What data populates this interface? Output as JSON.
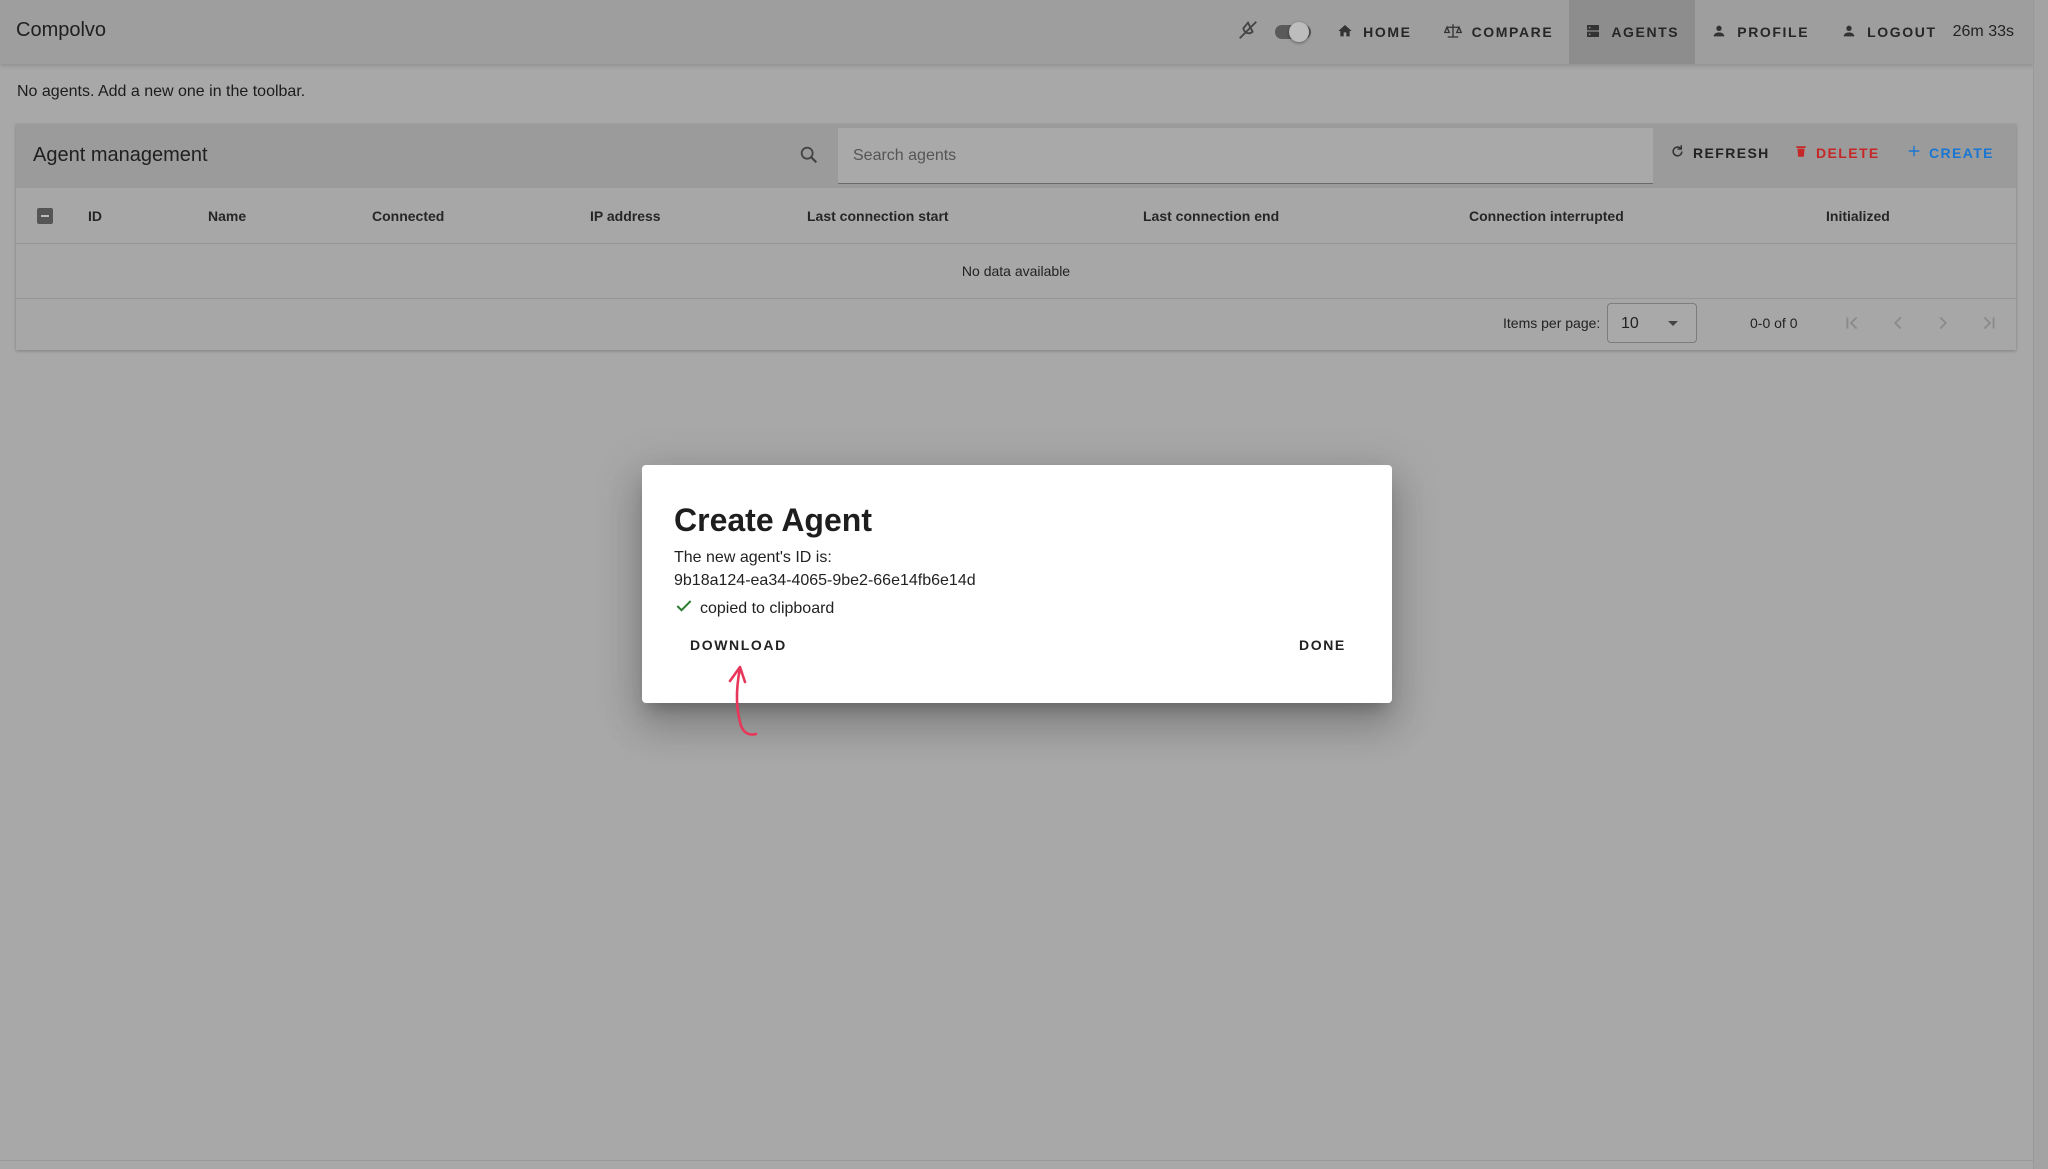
{
  "app": {
    "title": "Compolvo"
  },
  "nav": {
    "theme_icon": "invert-colors-off-icon",
    "items": [
      {
        "label": "HOME",
        "icon": "home-icon"
      },
      {
        "label": "COMPARE",
        "icon": "scale-balance-icon"
      },
      {
        "label": "AGENTS",
        "icon": "server-icon",
        "active": true
      },
      {
        "label": "PROFILE",
        "icon": "account-icon"
      },
      {
        "label": "LOGOUT",
        "icon": "account-icon"
      }
    ],
    "timer": "26m 33s"
  },
  "page": {
    "empty_message": "No agents. Add a new one in the toolbar."
  },
  "table": {
    "title": "Agent management",
    "search_placeholder": "Search agents",
    "actions": {
      "refresh": "REFRESH",
      "delete": "DELETE",
      "create": "CREATE"
    },
    "columns": [
      "ID",
      "Name",
      "Connected",
      "IP address",
      "Last connection start",
      "Last connection end",
      "Connection interrupted",
      "Initialized"
    ],
    "empty_text": "No data available",
    "items_per_page_label": "Items per page:",
    "items_per_page_value": "10",
    "range_text": "0-0 of 0"
  },
  "dialog": {
    "title": "Create Agent",
    "line1": "The new agent's ID is:",
    "agent_id": "9b18a124-ea34-4065-9be2-66e14fb6e14d",
    "copied_text": "copied to clipboard",
    "download_label": "DOWNLOAD",
    "done_label": "DONE"
  },
  "colors": {
    "delete": "#c62828",
    "create": "#1976d2",
    "check": "#2e7d32",
    "annotation": "#e8375a"
  }
}
